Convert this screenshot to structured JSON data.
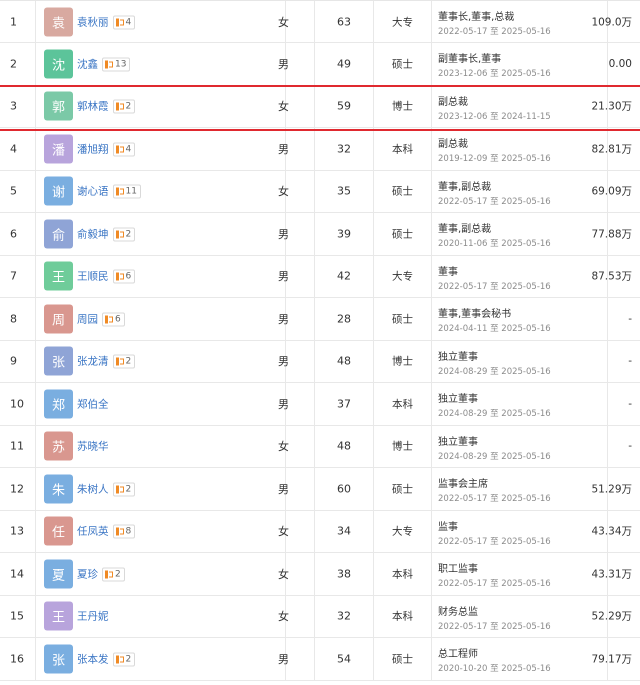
{
  "rows": [
    {
      "idx": "1",
      "avatar": "袁",
      "color": "#d8a9a0",
      "name": "袁秋丽",
      "badge": "4",
      "gender": "女",
      "age": "63",
      "edu": "大专",
      "title": "董事长,董事,总裁",
      "term": "2022-05-17 至 2025-05-16",
      "pay": "109.0万"
    },
    {
      "idx": "2",
      "avatar": "沈",
      "color": "#5cc49a",
      "name": "沈鑫",
      "badge": "13",
      "gender": "男",
      "age": "49",
      "edu": "硕士",
      "title": "副董事长,董事",
      "term": "2023-12-06 至 2025-05-16",
      "pay": "0.00"
    },
    {
      "idx": "3",
      "avatar": "郭",
      "color": "#7bc9a7",
      "name": "郭林霞",
      "badge": "2",
      "gender": "女",
      "age": "59",
      "edu": "博士",
      "title": "副总裁",
      "term": "2023-12-06 至 2024-11-15",
      "pay": "21.30万"
    },
    {
      "idx": "4",
      "avatar": "潘",
      "color": "#b8a4dc",
      "name": "潘旭翔",
      "badge": "4",
      "gender": "男",
      "age": "32",
      "edu": "本科",
      "title": "副总裁",
      "term": "2019-12-09 至 2025-05-16",
      "pay": "82.81万"
    },
    {
      "idx": "5",
      "avatar": "谢",
      "color": "#7aaee0",
      "name": "谢心语",
      "badge": "11",
      "gender": "女",
      "age": "35",
      "edu": "硕士",
      "title": "董事,副总裁",
      "term": "2022-05-17 至 2025-05-16",
      "pay": "69.09万"
    },
    {
      "idx": "6",
      "avatar": "俞",
      "color": "#8fa4d6",
      "name": "俞毅坤",
      "badge": "2",
      "gender": "男",
      "age": "39",
      "edu": "硕士",
      "title": "董事,副总裁",
      "term": "2020-11-06 至 2025-05-16",
      "pay": "77.88万"
    },
    {
      "idx": "7",
      "avatar": "王",
      "color": "#6fcc9a",
      "name": "王顺民",
      "badge": "6",
      "gender": "男",
      "age": "42",
      "edu": "大专",
      "title": "董事",
      "term": "2022-05-17 至 2025-05-16",
      "pay": "87.53万"
    },
    {
      "idx": "8",
      "avatar": "周",
      "color": "#d9978f",
      "name": "周园",
      "badge": "6",
      "gender": "男",
      "age": "28",
      "edu": "硕士",
      "title": "董事,董事会秘书",
      "term": "2024-04-11 至 2025-05-16",
      "pay": "-"
    },
    {
      "idx": "9",
      "avatar": "张",
      "color": "#8fa4d6",
      "name": "张龙清",
      "badge": "2",
      "gender": "男",
      "age": "48",
      "edu": "博士",
      "title": "独立董事",
      "term": "2024-08-29 至 2025-05-16",
      "pay": "-"
    },
    {
      "idx": "10",
      "avatar": "郑",
      "color": "#7aaee0",
      "name": "郑伯全",
      "badge": "",
      "gender": "男",
      "age": "37",
      "edu": "本科",
      "title": "独立董事",
      "term": "2024-08-29 至 2025-05-16",
      "pay": "-"
    },
    {
      "idx": "11",
      "avatar": "苏",
      "color": "#d9978f",
      "name": "苏晓华",
      "badge": "",
      "gender": "女",
      "age": "48",
      "edu": "博士",
      "title": "独立董事",
      "term": "2024-08-29 至 2025-05-16",
      "pay": "-"
    },
    {
      "idx": "12",
      "avatar": "朱",
      "color": "#7aaee0",
      "name": "朱树人",
      "badge": "2",
      "gender": "男",
      "age": "60",
      "edu": "硕士",
      "title": "监事会主席",
      "term": "2022-05-17 至 2025-05-16",
      "pay": "51.29万"
    },
    {
      "idx": "13",
      "avatar": "任",
      "color": "#d9978f",
      "name": "任凤英",
      "badge": "8",
      "gender": "女",
      "age": "34",
      "edu": "大专",
      "title": "监事",
      "term": "2022-05-17 至 2025-05-16",
      "pay": "43.34万"
    },
    {
      "idx": "14",
      "avatar": "夏",
      "color": "#7aaee0",
      "name": "夏珍",
      "badge": "2",
      "gender": "女",
      "age": "38",
      "edu": "本科",
      "title": "职工监事",
      "term": "2022-05-17 至 2025-05-16",
      "pay": "43.31万"
    },
    {
      "idx": "15",
      "avatar": "王",
      "color": "#b8a4dc",
      "name": "王丹妮",
      "badge": "",
      "gender": "女",
      "age": "32",
      "edu": "本科",
      "title": "财务总监",
      "term": "2022-05-17 至 2025-05-16",
      "pay": "52.29万"
    },
    {
      "idx": "16",
      "avatar": "张",
      "color": "#7aaee0",
      "name": "张本发",
      "badge": "2",
      "gender": "男",
      "age": "54",
      "edu": "硕士",
      "title": "总工程师",
      "term": "2020-10-20 至 2025-05-16",
      "pay": "79.17万"
    }
  ],
  "colors": {
    "link": "#3a75c4",
    "highlight": "#e0292f",
    "badge_icon": "#f08a24"
  }
}
